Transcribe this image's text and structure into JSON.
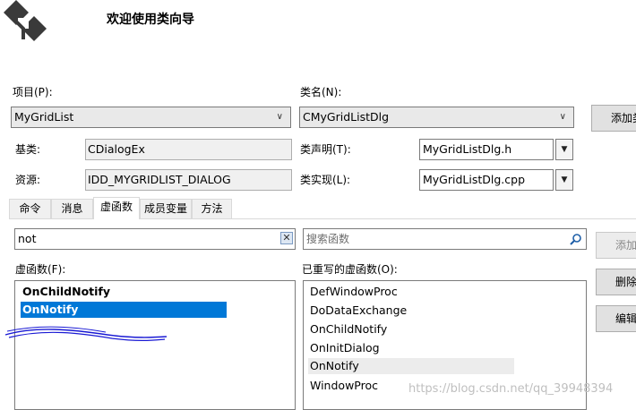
{
  "header": {
    "title": "欢迎使用类向导",
    "logo_icon": "class-wizard-logo"
  },
  "project": {
    "label": "项目(P):",
    "value": "MyGridList"
  },
  "classname": {
    "label": "类名(N):",
    "value": "CMyGridListDlg"
  },
  "add_class_button": "添加类",
  "base_class": {
    "label": "基类:",
    "value": "CDialogEx"
  },
  "class_decl": {
    "label": "类声明(T):",
    "value": "MyGridListDlg.h"
  },
  "resource": {
    "label": "资源:",
    "value": "IDD_MYGRIDLIST_DIALOG"
  },
  "class_impl": {
    "label": "类实现(L):",
    "value": "MyGridListDlg.cpp"
  },
  "tabs": [
    "命令",
    "消息",
    "虚函数",
    "成员变量",
    "方法"
  ],
  "active_tab": "虚函数",
  "filter": {
    "value": "not",
    "clear_icon": "close-icon"
  },
  "search": {
    "placeholder": "搜索函数",
    "icon": "search-icon"
  },
  "virtual_functions": {
    "label": "虚函数(F):",
    "items": [
      "OnChildNotify",
      "OnNotify"
    ],
    "selected": "OnNotify"
  },
  "overridden_functions": {
    "label": "已重写的虚函数(O):",
    "items": [
      "DefWindowProc",
      "DoDataExchange",
      "OnChildNotify",
      "OnInitDialog",
      "OnNotify",
      "WindowProc"
    ],
    "highlighted": "OnNotify"
  },
  "side_buttons": [
    "添加函数",
    "删除函数",
    "编辑代码"
  ],
  "watermark": "https://blog.csdn.net/qq_39948394",
  "colors": {
    "selection": "#0078d7",
    "highlight": "#e8e8e8",
    "annotation": "#1a1ad4"
  }
}
